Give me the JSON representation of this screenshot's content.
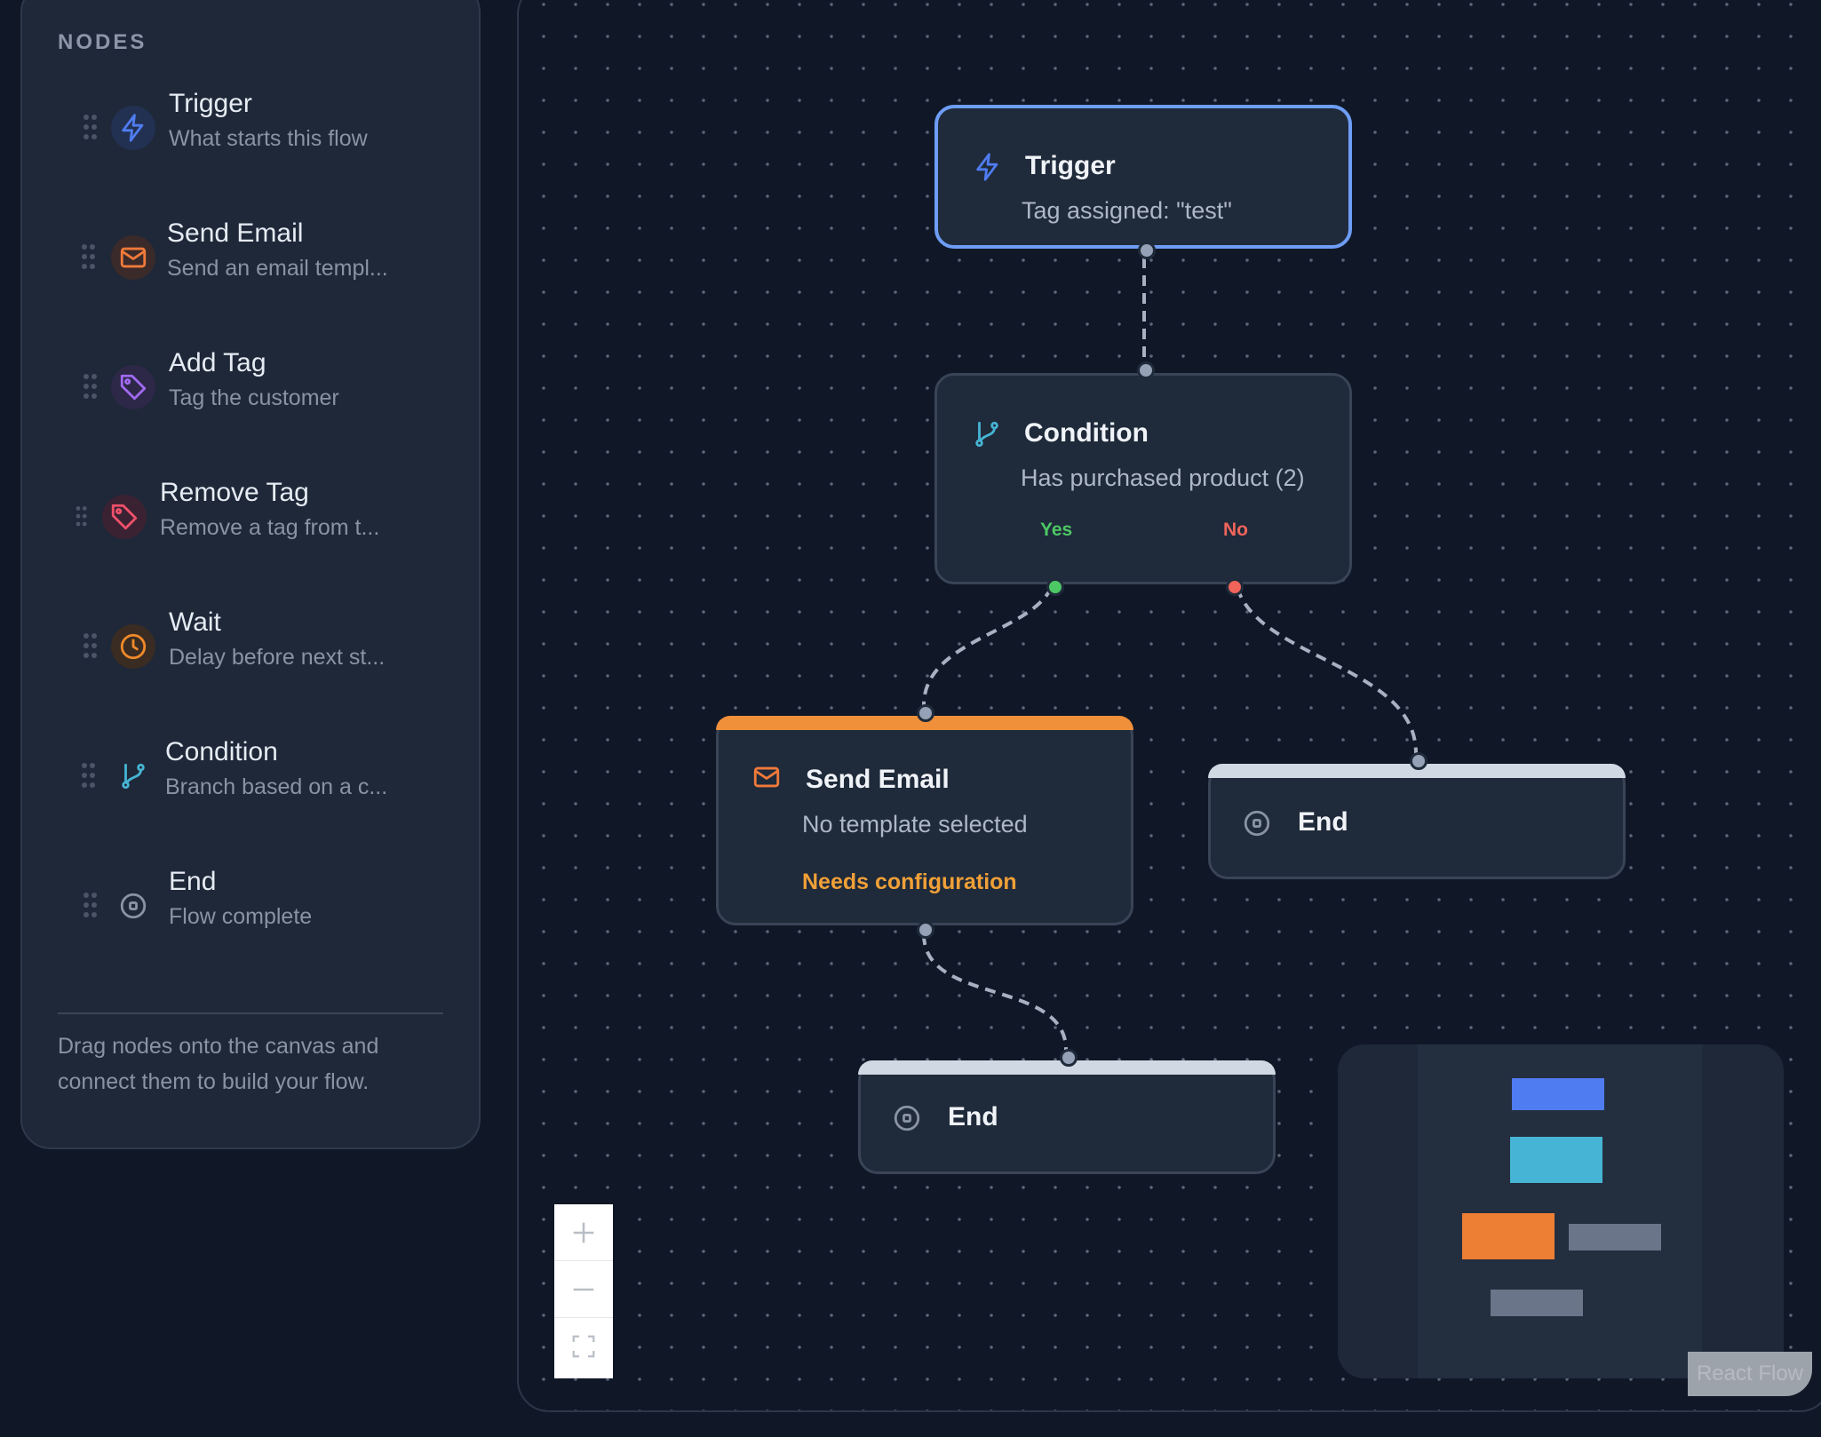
{
  "sidebar": {
    "title": "NODES",
    "items": [
      {
        "label": "Trigger",
        "description": "What starts this flow",
        "icon": "lightning-icon",
        "color": "#4f7cf0"
      },
      {
        "label": "Send Email",
        "description": "Send an email templ...",
        "icon": "mail-icon",
        "color": "#f07a3a"
      },
      {
        "label": "Add Tag",
        "description": "Tag the customer",
        "icon": "tag-icon",
        "color": "#a06af0"
      },
      {
        "label": "Remove Tag",
        "description": "Remove a tag from t...",
        "icon": "tag-icon",
        "color": "#f0506a"
      },
      {
        "label": "Wait",
        "description": "Delay before next st...",
        "icon": "clock-icon",
        "color": "#f08a2a"
      },
      {
        "label": "Condition",
        "description": "Branch based on a c...",
        "icon": "branch-icon",
        "color": "#46b4d4"
      },
      {
        "label": "End",
        "description": "Flow complete",
        "icon": "stop-circle-icon",
        "color": "#8a93a3"
      }
    ],
    "hint": "Drag nodes onto the canvas and connect them to build your flow."
  },
  "canvas": {
    "nodes": {
      "trigger": {
        "title": "Trigger",
        "subtitle": "Tag assigned: \"test\""
      },
      "condition": {
        "title": "Condition",
        "subtitle": "Has purchased product (2)",
        "yes_label": "Yes",
        "no_label": "No"
      },
      "send_email": {
        "title": "Send Email",
        "subtitle": "No template selected",
        "warning": "Needs configuration"
      },
      "end_right": {
        "title": "End"
      },
      "end_bottom": {
        "title": "End"
      }
    },
    "controls": {
      "zoom_in": "+",
      "zoom_out": "−",
      "fit_view": "fit-view"
    },
    "attribution": "React Flow"
  },
  "colors": {
    "accent_blue": "#6d9df5",
    "trigger": "#4f7cf0",
    "email": "#f0903a",
    "condition": "#46b4d4",
    "yes": "#4cc764",
    "no": "#f0645a",
    "end_bar": "#d0d8e4"
  }
}
